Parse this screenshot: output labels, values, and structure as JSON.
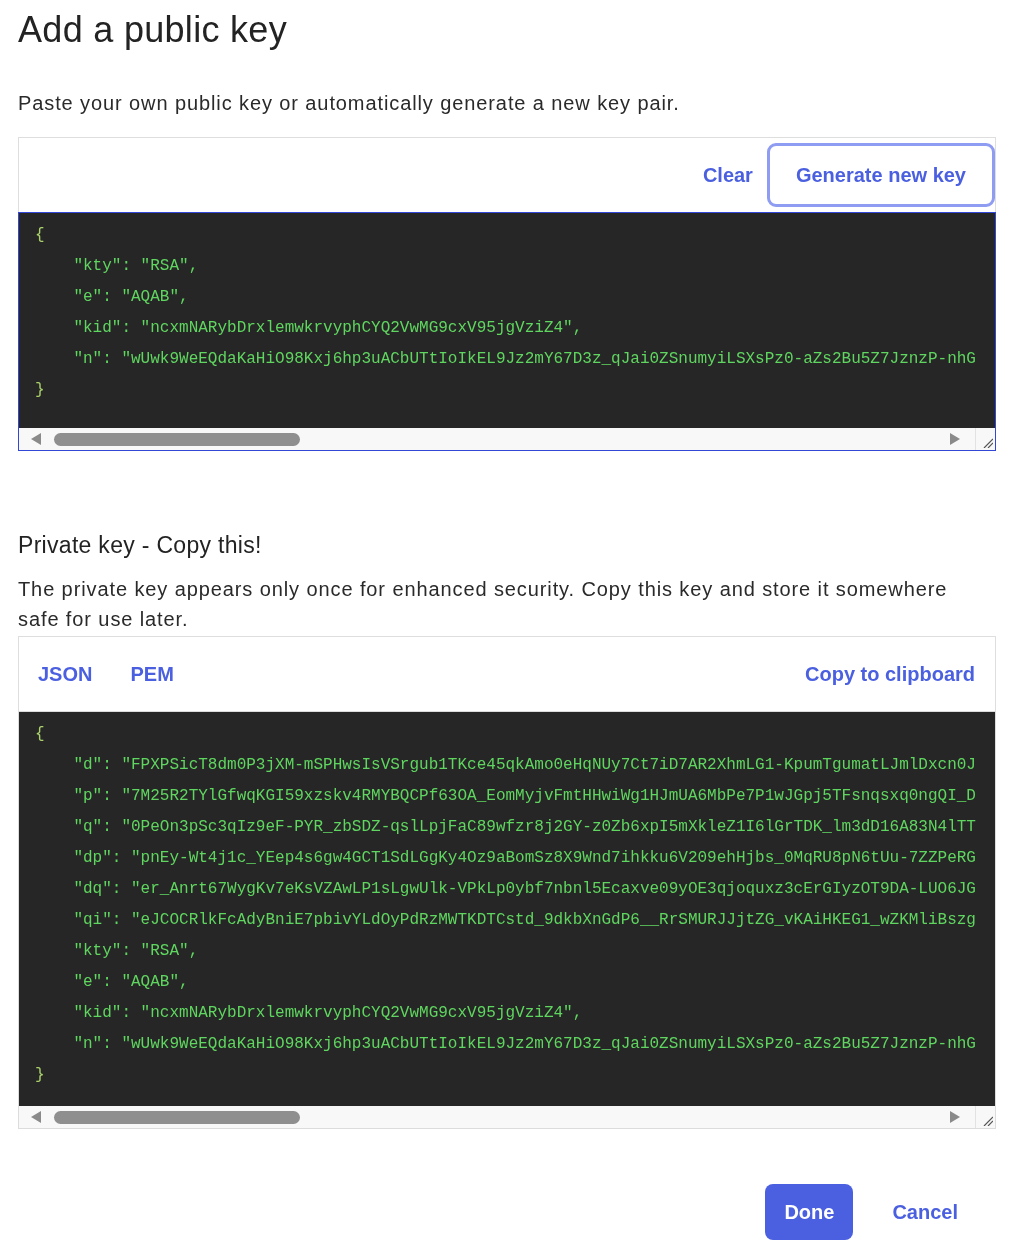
{
  "title": "Add a public key",
  "description": "Paste your own public key or automatically generate a new key pair.",
  "public_key": {
    "actions": [
      {
        "label": "Clear",
        "focused": false
      },
      {
        "label": "Generate new key",
        "focused": true
      }
    ],
    "editor": {
      "focused": true,
      "open": "{",
      "entries": [
        "\"kty\": \"RSA\",",
        "\"e\": \"AQAB\",",
        "\"kid\": \"ncxmNARybDrxlemwkrvyphCYQ2VwMG9cxV95jgVziZ4\",",
        "\"n\": \"wUwk9WeEQdaKaHiO98Kxj6hp3uACbUTtIoIkEL9Jz2mY67D3z_qJai0ZSnumyiLSXsPz0-aZs2Bu5Z7JznzP-nhG"
      ],
      "close": "}"
    }
  },
  "private_key": {
    "heading": "Private key - Copy this!",
    "description": "The private key appears only once for enhanced security. Copy this key and store it somewhere safe for use later.",
    "formats": [
      "JSON",
      "PEM"
    ],
    "copy_label": "Copy to clipboard",
    "editor": {
      "focused": false,
      "open": "{",
      "entries": [
        "\"d\": \"FPXPSicT8dm0P3jXM-mSPHwsIsVSrgub1TKce45qkAmo0eHqNUy7Ct7iD7AR2XhmLG1-KpumTgumatLJmlDxcn0J",
        "\"p\": \"7M25R2TYlGfwqKGI59xzskv4RMYBQCPf63OA_EomMyjvFmtHHwiWg1HJmUA6MbPe7P1wJGpj5TFsnqsxq0ngQI_D",
        "\"q\": \"0PeOn3pSc3qIz9eF-PYR_zbSDZ-qslLpjFaC89wfzr8j2GY-z0Zb6xpI5mXkleZ1I6lGrTDK_lm3dD16A83N4lTT",
        "\"dp\": \"pnEy-Wt4j1c_YEep4s6gw4GCT1SdLGgKy4Oz9aBomSz8X9Wnd7ihkku6V209ehHjbs_0MqRU8pN6tUu-7ZZPeRG",
        "\"dq\": \"er_Anrt67WygKv7eKsVZAwLP1sLgwUlk-VPkLp0ybf7nbnl5Ecaxve09yOE3qjoquxz3cErGIyzOT9DA-LUO6JG",
        "\"qi\": \"eJCOCRlkFcAdyBniE7pbivYLdOyPdRzMWTKDTCstd_9dkbXnGdP6__RrSMURJJjtZG_vKAiHKEG1_wZKMliBszg",
        "\"kty\": \"RSA\",",
        "\"e\": \"AQAB\",",
        "\"kid\": \"ncxmNARybDrxlemwkrvyphCYQ2VwMG9cxV95jgVziZ4\",",
        "\"n\": \"wUwk9WeEQdaKaHiO98Kxj6hp3uACbUTtIoIkEL9Jz2mY67D3z_qJai0ZSnumyiLSXsPz0-aZs2Bu5Z7JznzP-nhG"
      ],
      "close": "}"
    }
  },
  "buttons": [
    {
      "label": "Done",
      "kind": "primary"
    },
    {
      "label": "Cancel",
      "kind": "secondary"
    }
  ]
}
